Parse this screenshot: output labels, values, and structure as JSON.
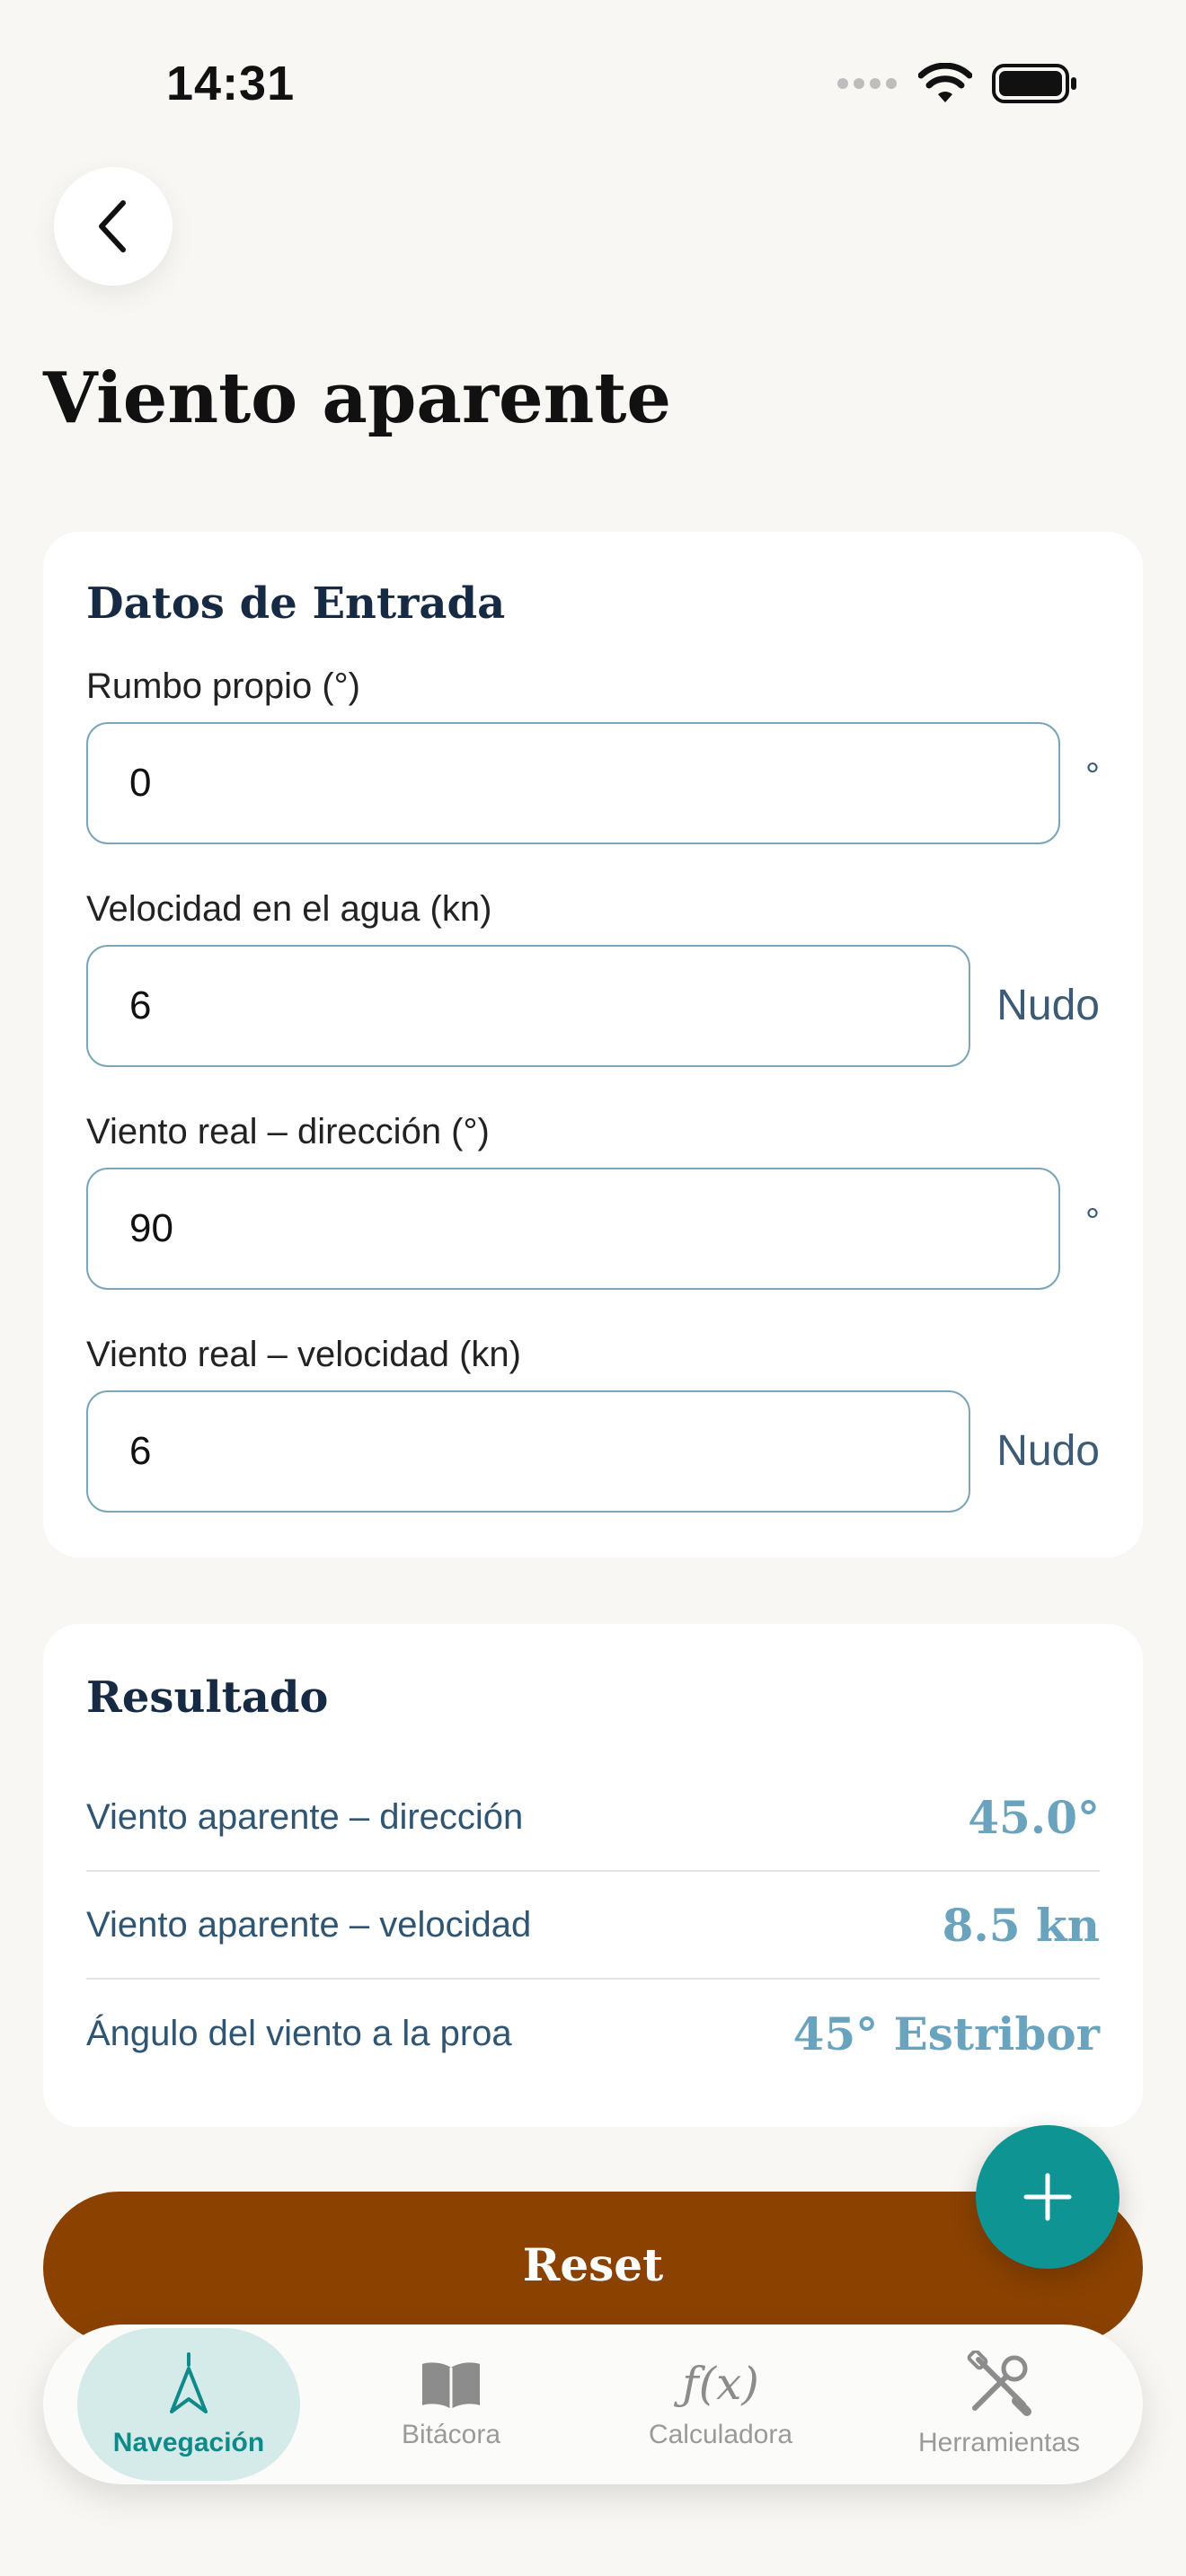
{
  "status_bar": {
    "time": "14:31"
  },
  "header": {
    "title": "Viento aparente"
  },
  "input_card": {
    "title": "Datos de Entrada",
    "fields": [
      {
        "label": "Rumbo propio (°)",
        "value": "0",
        "unit": "°"
      },
      {
        "label": "Velocidad en el agua (kn)",
        "value": "6",
        "unit": "Nudo"
      },
      {
        "label": "Viento real – dirección (°)",
        "value": "90",
        "unit": "°"
      },
      {
        "label": "Viento real – velocidad (kn)",
        "value": "6",
        "unit": "Nudo"
      }
    ]
  },
  "result_card": {
    "title": "Resultado",
    "rows": [
      {
        "label": "Viento aparente – dirección",
        "value": "45.0°"
      },
      {
        "label": "Viento aparente – velocidad",
        "value": "8.5 kn"
      },
      {
        "label": "Ángulo del viento a la proa",
        "value": "45° Estribor"
      }
    ]
  },
  "reset_button": {
    "label": "Reset"
  },
  "tab_bar": {
    "active": "Navegación",
    "tabs": [
      {
        "label": "Navegación",
        "icon": "navigation-arrow-icon"
      },
      {
        "label": "Bitácora",
        "icon": "book-icon"
      },
      {
        "label": "Calculadora",
        "icon": "function-icon",
        "icon_text": "ƒ(x)"
      },
      {
        "label": "Herramientas",
        "icon": "tools-icon"
      }
    ]
  },
  "colors": {
    "accent": "#0f9494",
    "reset": "#8b4200",
    "result_value": "#6aa3bd",
    "input_border": "#7aa6b7",
    "background": "#f8f7f4"
  }
}
